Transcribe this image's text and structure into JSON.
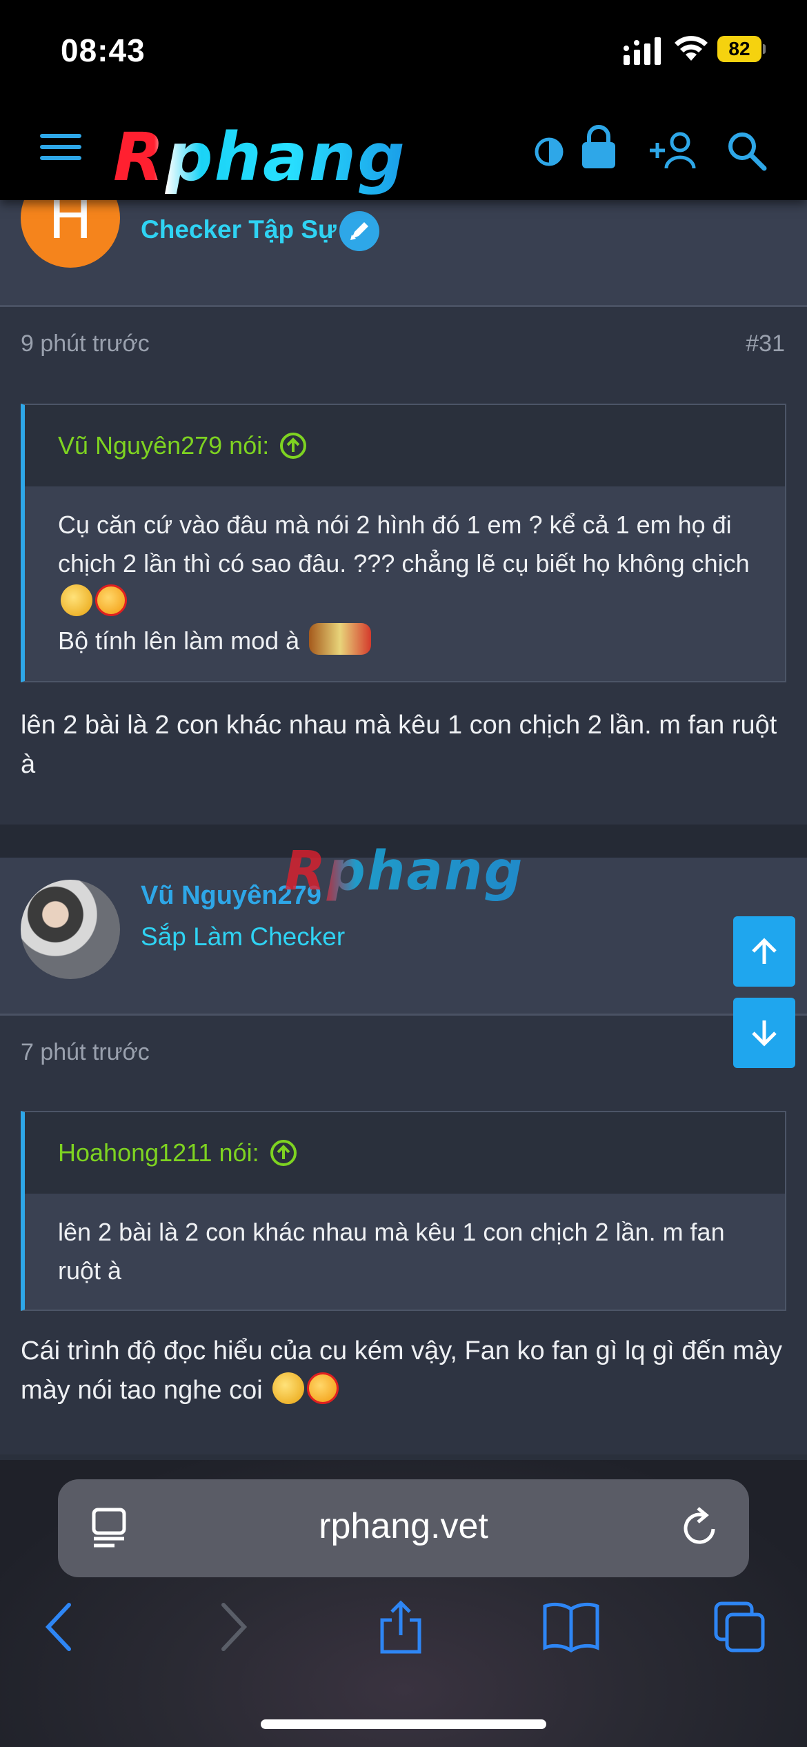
{
  "status": {
    "time": "08:43",
    "battery": "82"
  },
  "header": {
    "logo": "Rphang"
  },
  "post1": {
    "role": "Checker Tập Sự",
    "avatar_letter": "H",
    "time": "9 phút trước",
    "number": "#31",
    "quote_author": "Vũ Nguyên279 nói:",
    "quote_line1": "Cụ căn cứ vào đâu mà nói 2 hình đó 1 em ? kể cả 1 em họ đi chịch 2 lần thì có sao đâu. ??? chẳng lẽ cụ biết họ không chịch",
    "quote_line2": "Bộ tính lên làm mod à",
    "text": "lên 2 bài là 2 con khác nhau mà kêu 1 con chịch 2 lần. m fan ruột à"
  },
  "post2": {
    "username": "Vũ Nguyên279",
    "role": "Sắp Làm Checker",
    "time": "7 phút trước",
    "quote_author": "Hoahong1211 nói:",
    "quote_text": "lên 2 bài là 2 con khác nhau mà kêu 1 con chịch 2 lần. m fan ruột à",
    "text": "Cái trình độ đọc hiểu của cu kém vậy, Fan ko fan gì lq gì đến mày mày nói tao nghe coi"
  },
  "watermark": "Rphang",
  "browser": {
    "url": "rphang.vet"
  },
  "colors": {
    "accent": "#2ea7e8",
    "role": "#2fd3f3",
    "quote_author": "#7ed321",
    "avatar_h": "#f5841c"
  }
}
